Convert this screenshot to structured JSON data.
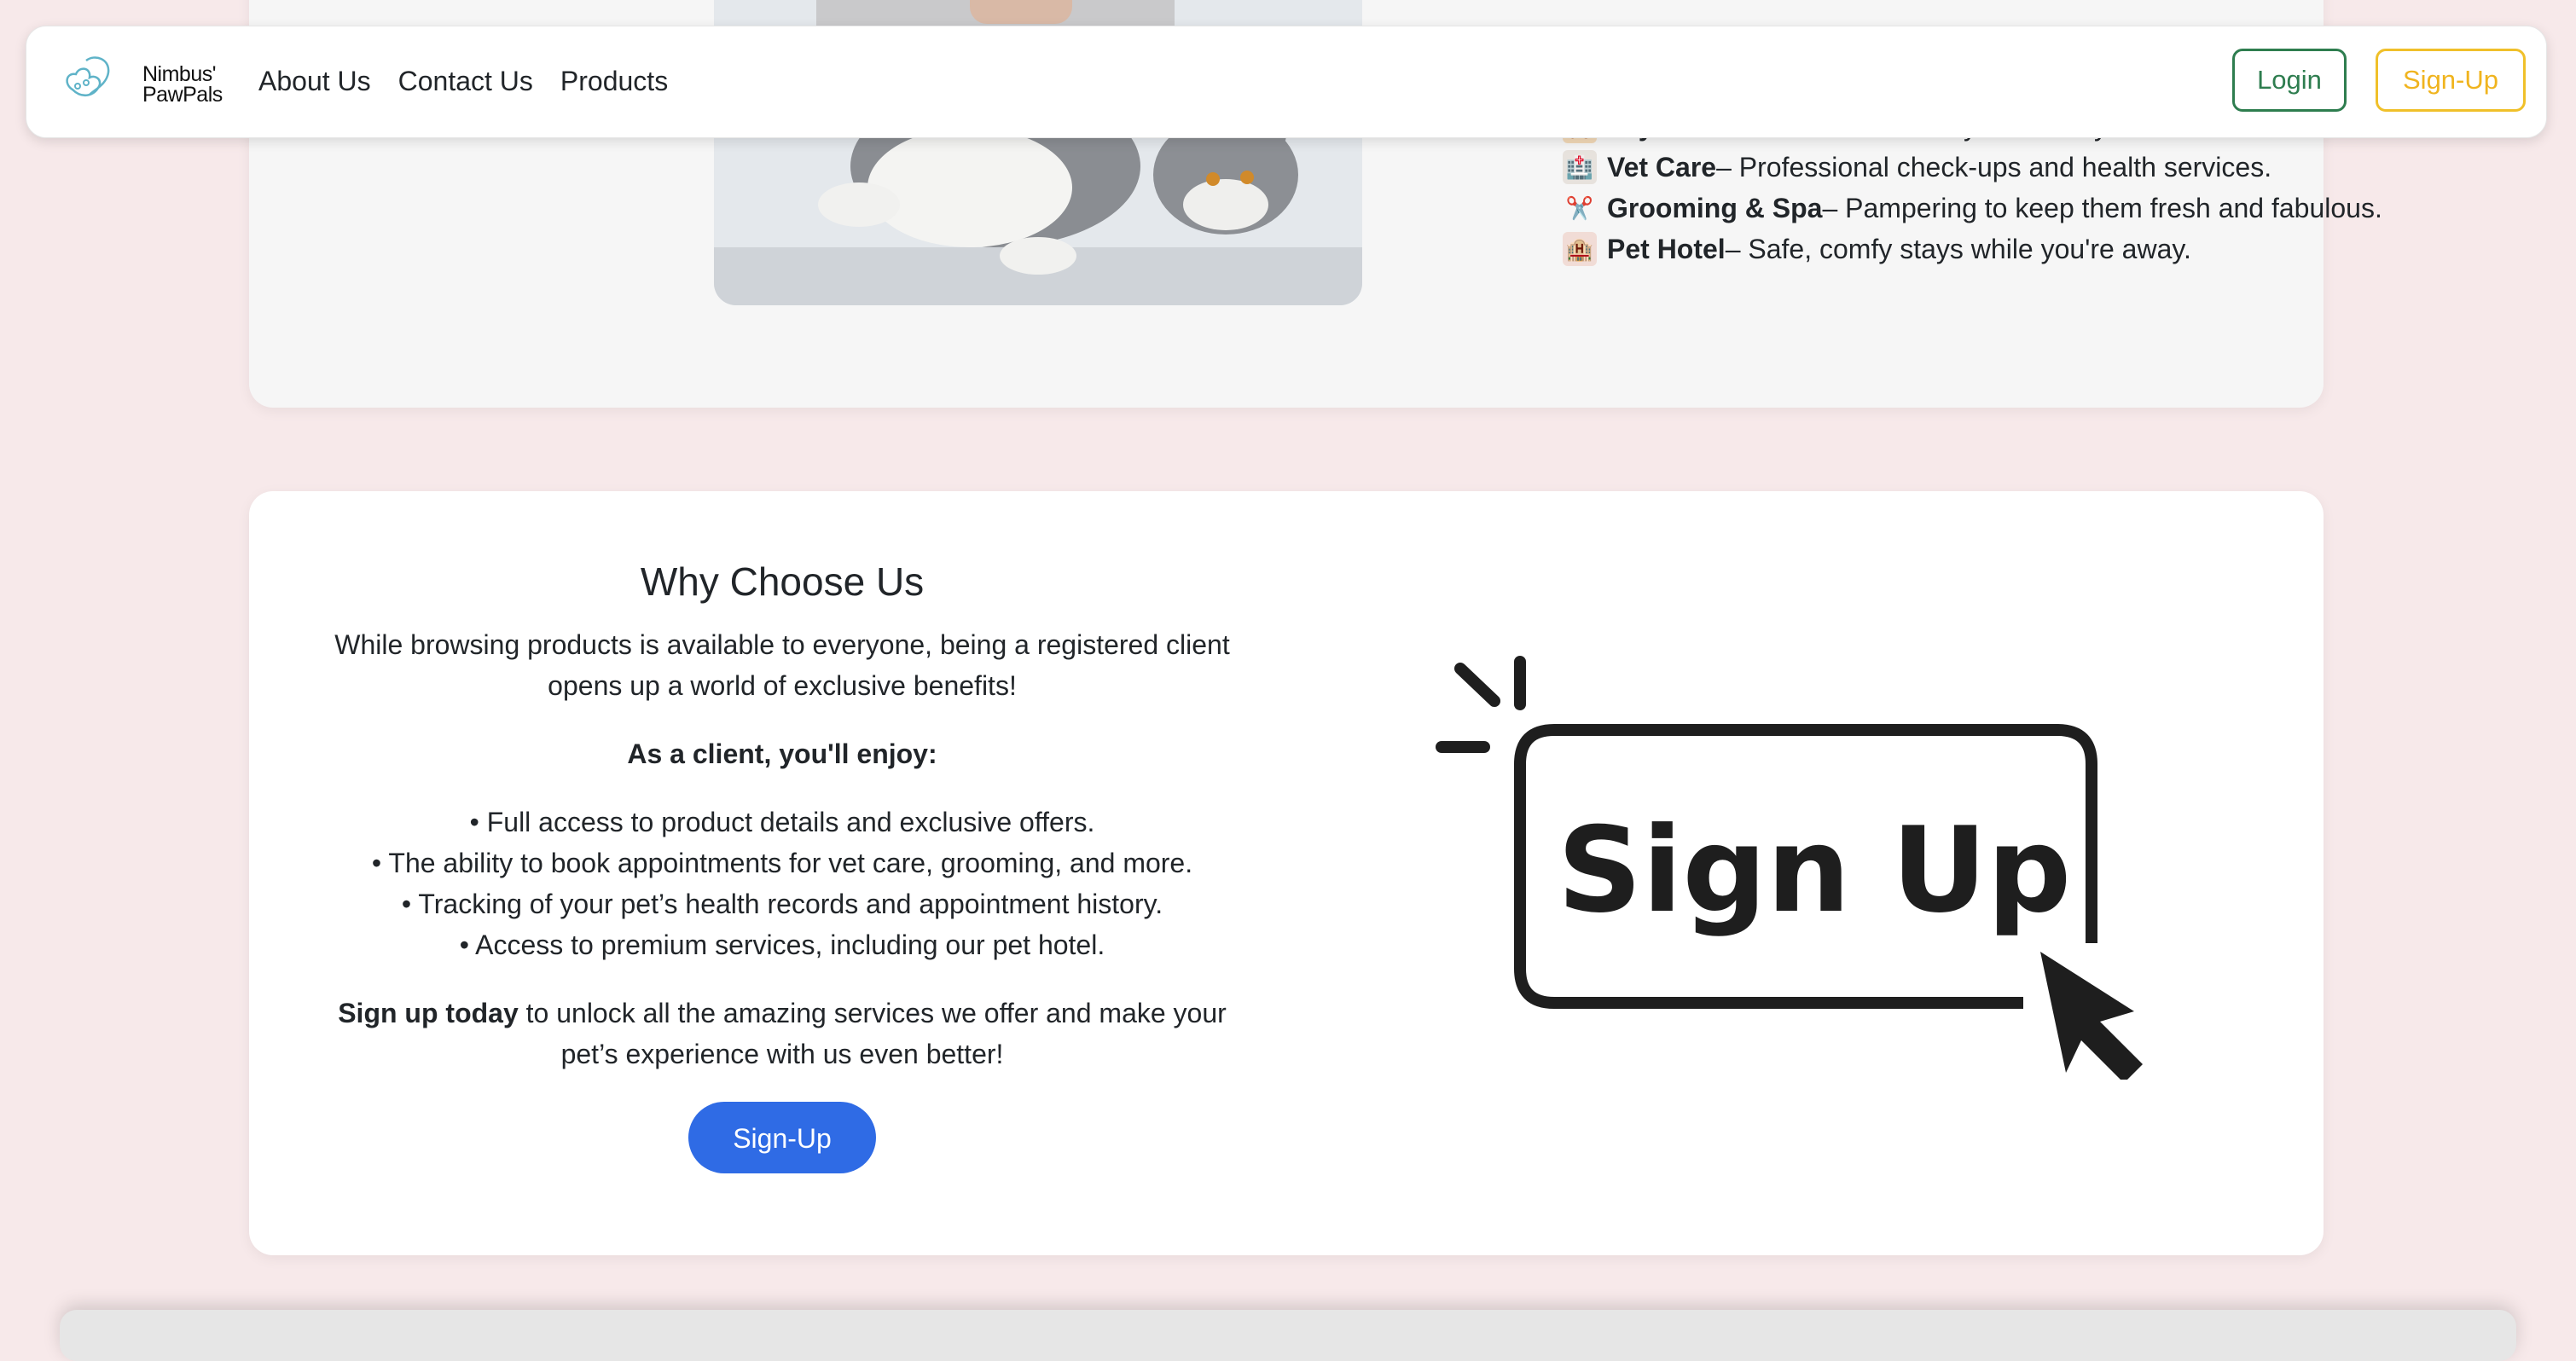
{
  "brand": {
    "line1": "Nimbus'",
    "line2": "PawPals"
  },
  "nav": {
    "links": [
      "About Us",
      "Contact Us",
      "Products"
    ],
    "login": "Login",
    "signup": "Sign-Up"
  },
  "services": [
    {
      "icon": "teddy-bear",
      "name": "Toys & Accessories",
      "desc": "– Fun toys and cozy essentials."
    },
    {
      "icon": "hospital",
      "name": "Vet Care",
      "desc": "– Professional check-ups and health services."
    },
    {
      "icon": "scissors",
      "name": "Grooming & Spa",
      "desc": "– Pampering to keep them fresh and fabulous."
    },
    {
      "icon": "hotel",
      "name": "Pet Hotel",
      "desc": "– Safe, comfy stays while you're away."
    }
  ],
  "why": {
    "title": "Why Choose Us",
    "intro": "While browsing products is available to everyone, being a registered client opens up a world of exclusive benefits!",
    "subtitle": "As a client, you'll enjoy:",
    "benefits": [
      "• Full access to product details and exclusive offers.",
      "• The ability to book appointments for vet care, grooming, and more.",
      "• Tracking of your pet’s health records and appointment history.",
      "• Access to premium services, including our pet hotel."
    ],
    "cta_bold": "Sign up today",
    "cta_rest": " to unlock all the amazing services we offer and make your pet’s experience with us even better!",
    "button": "Sign-Up",
    "illustration_text": "Sign Up"
  },
  "colors": {
    "background": "#f7e9ea",
    "login": "#2e7d4f",
    "signup": "#f0b41e",
    "primary": "#2f6be5"
  }
}
